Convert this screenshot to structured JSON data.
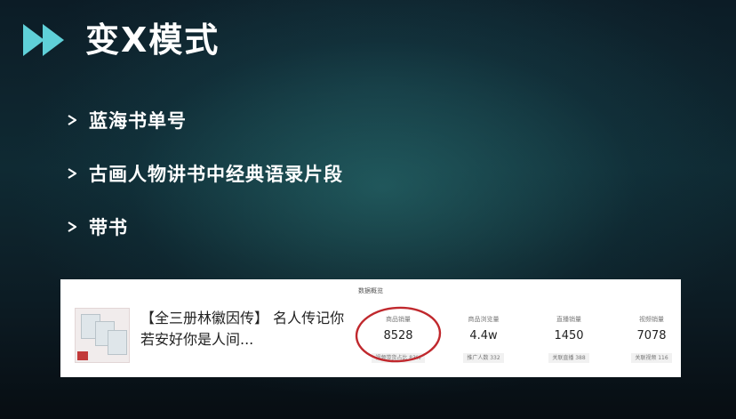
{
  "slide": {
    "title": "变X模式",
    "play_icon": "fast-forward-icon",
    "accent_color": "#5fd0d8",
    "bullet_icon": "arrow-right-icon",
    "bullets": [
      {
        "text": "蓝海书单号"
      },
      {
        "text": "古画人物讲书中经典语录片段"
      },
      {
        "text": "带书"
      }
    ]
  },
  "data_card": {
    "heading": "数据概览",
    "product_title": "【全三册林徽因传】 名人传记你若安好你是人间...",
    "metrics": [
      {
        "label": "商品销量",
        "value": "8528",
        "sub": "视频带货占比 83%",
        "highlighted": true
      },
      {
        "label": "商品浏览量",
        "value": "4.4w",
        "sub": "推广人数 332"
      },
      {
        "label": "直播销量",
        "value": "1450",
        "sub": "关联直播 388"
      },
      {
        "label": "视频销量",
        "value": "7078",
        "sub": "关联视频 116"
      }
    ],
    "highlight_color": "#c0282d"
  }
}
